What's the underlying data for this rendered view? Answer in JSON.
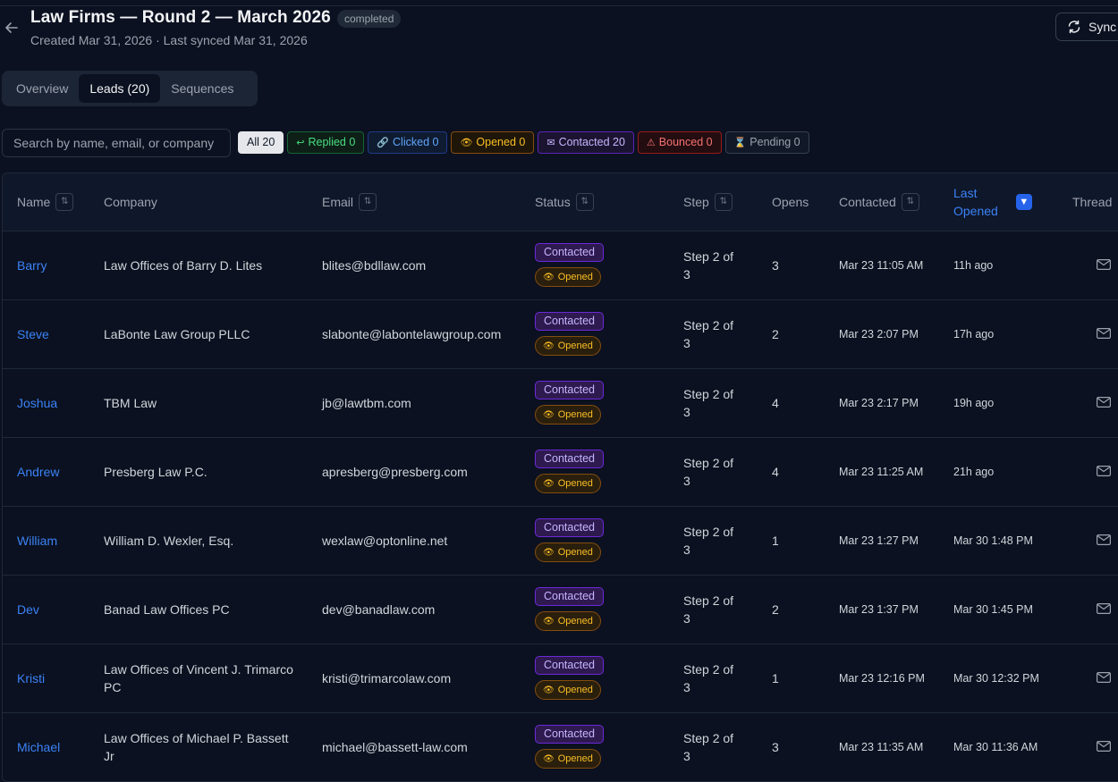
{
  "header": {
    "title": "Law Firms — Round 2 — March 2026",
    "status": "completed",
    "subtitle": "Created Mar 31, 2026 · Last synced Mar 31, 2026",
    "sync_label": "Sync"
  },
  "tabs": [
    {
      "label": "Overview"
    },
    {
      "label": "Leads (20)"
    },
    {
      "label": "Sequences"
    }
  ],
  "search": {
    "placeholder": "Search by name, email, or company"
  },
  "filters": {
    "all": "All 20",
    "replied": "Replied 0",
    "clicked": "Clicked 0",
    "opened": "Opened 0",
    "contacted": "Contacted 20",
    "bounced": "Bounced 0",
    "pending": "Pending 0"
  },
  "columns": {
    "name": "Name",
    "company": "Company",
    "email": "Email",
    "status": "Status",
    "step": "Step",
    "opens": "Opens",
    "contacted": "Contacted",
    "last_opened_1": "Last",
    "last_opened_2": "Opened",
    "thread": "Thread"
  },
  "badges": {
    "contacted": "Contacted",
    "opened": "Opened"
  },
  "rows": [
    {
      "name": "Barry",
      "company": "Law Offices of Barry D. Lites",
      "email": "blites@bdllaw.com",
      "step1": "Step 2 of",
      "step2": "3",
      "opens": "3",
      "contacted": "Mar 23 11:05 AM",
      "last_opened": "11h ago"
    },
    {
      "name": "Steve",
      "company": "LaBonte Law Group PLLC",
      "email": "slabonte@labontelawgroup.com",
      "step1": "Step 2 of",
      "step2": "3",
      "opens": "2",
      "contacted": "Mar 23 2:07 PM",
      "last_opened": "17h ago"
    },
    {
      "name": "Joshua",
      "company": "TBM Law",
      "email": "jb@lawtbm.com",
      "step1": "Step 2 of",
      "step2": "3",
      "opens": "4",
      "contacted": "Mar 23 2:17 PM",
      "last_opened": "19h ago"
    },
    {
      "name": "Andrew",
      "company": "Presberg Law P.C.",
      "email": "apresberg@presberg.com",
      "step1": "Step 2 of",
      "step2": "3",
      "opens": "4",
      "contacted": "Mar 23 11:25 AM",
      "last_opened": "21h ago"
    },
    {
      "name": "William",
      "company": "William D. Wexler, Esq.",
      "email": "wexlaw@optonline.net",
      "step1": "Step 2 of",
      "step2": "3",
      "opens": "1",
      "contacted": "Mar 23 1:27 PM",
      "last_opened": "Mar 30 1:48 PM"
    },
    {
      "name": "Dev",
      "company": "Banad Law Offices PC",
      "email": "dev@banadlaw.com",
      "step1": "Step 2 of",
      "step2": "3",
      "opens": "2",
      "contacted": "Mar 23 1:37 PM",
      "last_opened": "Mar 30 1:45 PM"
    },
    {
      "name": "Kristi",
      "company": "Law Offices of Vincent J. Trimarco PC",
      "email": "kristi@trimarcolaw.com",
      "step1": "Step 2 of",
      "step2": "3",
      "opens": "1",
      "contacted": "Mar 23 12:16 PM",
      "last_opened": "Mar 30 12:32 PM"
    },
    {
      "name": "Michael",
      "company": "Law Offices of Michael P. Bassett Jr",
      "email": "michael@bassett-law.com",
      "step1": "Step 2 of",
      "step2": "3",
      "opens": "3",
      "contacted": "Mar 23 11:35 AM",
      "last_opened": "Mar 30 11:36 AM"
    }
  ]
}
